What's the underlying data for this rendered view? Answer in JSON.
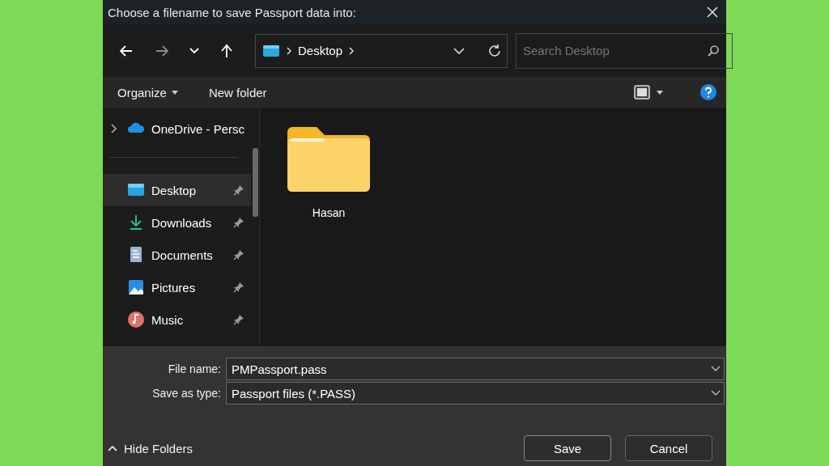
{
  "window": {
    "title": "Choose a filename to save Passport data into:"
  },
  "nav": [
    {
      "kind": "back",
      "disabled": false
    },
    {
      "kind": "forward",
      "disabled": true
    },
    {
      "kind": "recent",
      "disabled": false
    },
    {
      "kind": "up",
      "disabled": false
    }
  ],
  "address": {
    "crumbs": [
      "Desktop"
    ]
  },
  "search": {
    "placeholder": "Search Desktop"
  },
  "toolbar": {
    "organize": "Organize",
    "new_folder": "New folder"
  },
  "sidebar": {
    "items": [
      {
        "kind": "onedrive",
        "label": "OneDrive - Persc",
        "selected": false,
        "pinned": false,
        "expandable": true
      },
      {
        "kind": "desktop",
        "label": "Desktop",
        "selected": true,
        "pinned": true,
        "expandable": false
      },
      {
        "kind": "downloads",
        "label": "Downloads",
        "selected": false,
        "pinned": true,
        "expandable": false
      },
      {
        "kind": "documents",
        "label": "Documents",
        "selected": false,
        "pinned": true,
        "expandable": false
      },
      {
        "kind": "pictures",
        "label": "Pictures",
        "selected": false,
        "pinned": true,
        "expandable": false
      },
      {
        "kind": "music",
        "label": "Music",
        "selected": false,
        "pinned": true,
        "expandable": false
      }
    ]
  },
  "files": [
    {
      "name": "Hasan"
    }
  ],
  "file_name": {
    "label": "File name:",
    "value": "PMPassport.pass"
  },
  "save_as_type": {
    "label": "Save as type:",
    "value": "Passport files (*.PASS)"
  },
  "hide_folders": "Hide Folders",
  "buttons": [
    "Save",
    "Cancel"
  ]
}
